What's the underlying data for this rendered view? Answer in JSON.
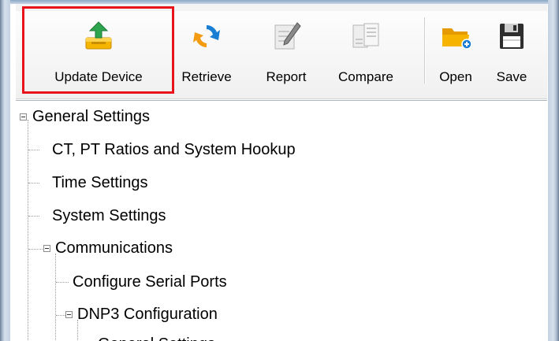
{
  "toolbar": {
    "buttons": [
      {
        "label": "Update Device",
        "icon": "upload-tray-icon"
      },
      {
        "label": "Retrieve",
        "icon": "refresh-icon"
      },
      {
        "label": "Report",
        "icon": "report-pen-icon"
      },
      {
        "label": "Compare",
        "icon": "compare-documents-icon"
      },
      {
        "label": "Open",
        "icon": "folder-open-icon"
      },
      {
        "label": "Save",
        "icon": "floppy-disk-icon"
      }
    ],
    "highlighted_button": "Update Device"
  },
  "tree": {
    "items": [
      {
        "label": "General Settings",
        "expanded": true
      },
      {
        "label": "CT, PT Ratios and System Hookup"
      },
      {
        "label": "Time Settings"
      },
      {
        "label": "System Settings"
      },
      {
        "label": "Communications",
        "expanded": true
      },
      {
        "label": "Configure Serial Ports"
      },
      {
        "label": "DNP3 Configuration",
        "expanded": true
      },
      {
        "label": "General Settings"
      }
    ]
  },
  "colors": {
    "highlight_border": "#e8141b",
    "upload_arrow": "#2fa44f",
    "refresh": "#1a7fd4",
    "folder": "#f6a800"
  }
}
